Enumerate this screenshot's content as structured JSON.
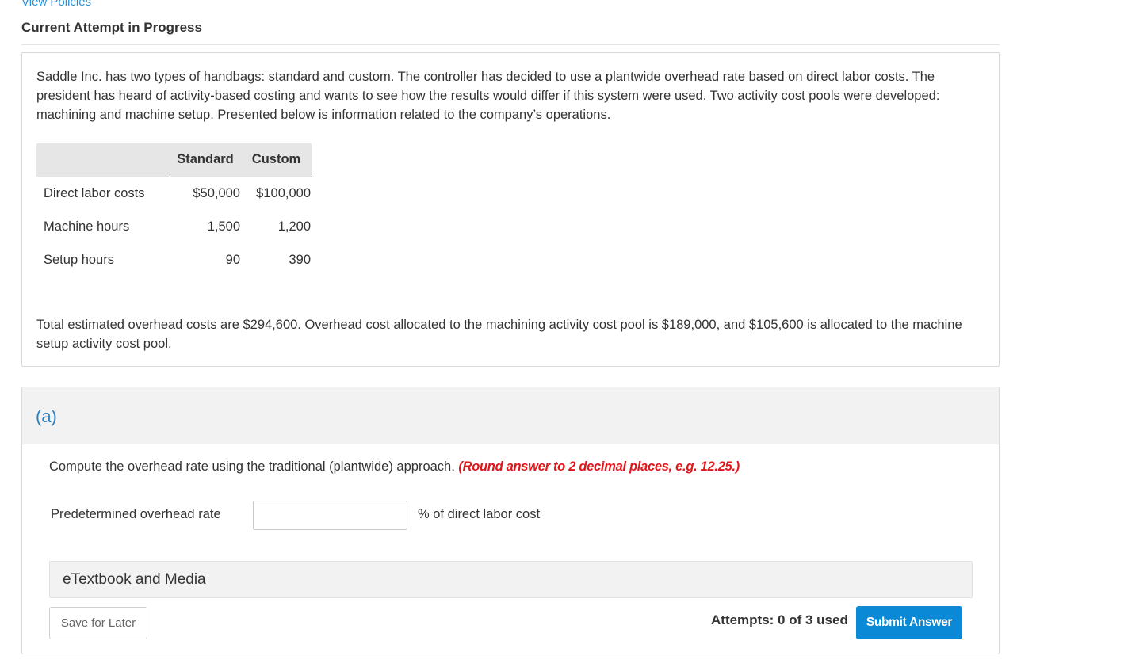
{
  "header": {
    "view_policies": "View Policies",
    "attempt_title": "Current Attempt in Progress"
  },
  "question": {
    "intro": "Saddle Inc. has two types of handbags: standard and custom. The controller has decided to use a plantwide overhead rate based on direct labor costs. The president has heard of activity-based costing and wants to see how the results would differ if this system were used. Two activity cost pools were developed: machining and machine setup. Presented below is information related to the company’s operations.",
    "table": {
      "headers": [
        "Standard",
        "Custom"
      ],
      "rows": [
        {
          "label": "Direct labor costs",
          "standard": "$50,000",
          "custom": "$100,000"
        },
        {
          "label": "Machine hours",
          "standard": "1,500",
          "custom": "1,200"
        },
        {
          "label": "Setup hours",
          "standard": "90",
          "custom": "390"
        }
      ]
    },
    "closing": "Total estimated overhead costs are $294,600. Overhead cost allocated to the machining activity cost pool is $189,000, and $105,600 is allocated to the machine setup activity cost pool."
  },
  "part_a": {
    "label": "(a)",
    "instruction": "Compute the overhead rate using the traditional (plantwide) approach.",
    "rounding_note": "(Round answer to 2 decimal places, e.g. 12.25.)",
    "rate_label": "Predetermined overhead rate",
    "rate_value": "",
    "rate_unit": "% of direct labor cost",
    "etextbook": "eTextbook and Media",
    "save_label": "Save for Later",
    "attempts": "Attempts: 0 of 3 used",
    "submit_label": "Submit Answer"
  },
  "colors": {
    "link": "#2a8fd6",
    "rounding_note": "#e0161b",
    "submit_button": "#0a89d6"
  }
}
